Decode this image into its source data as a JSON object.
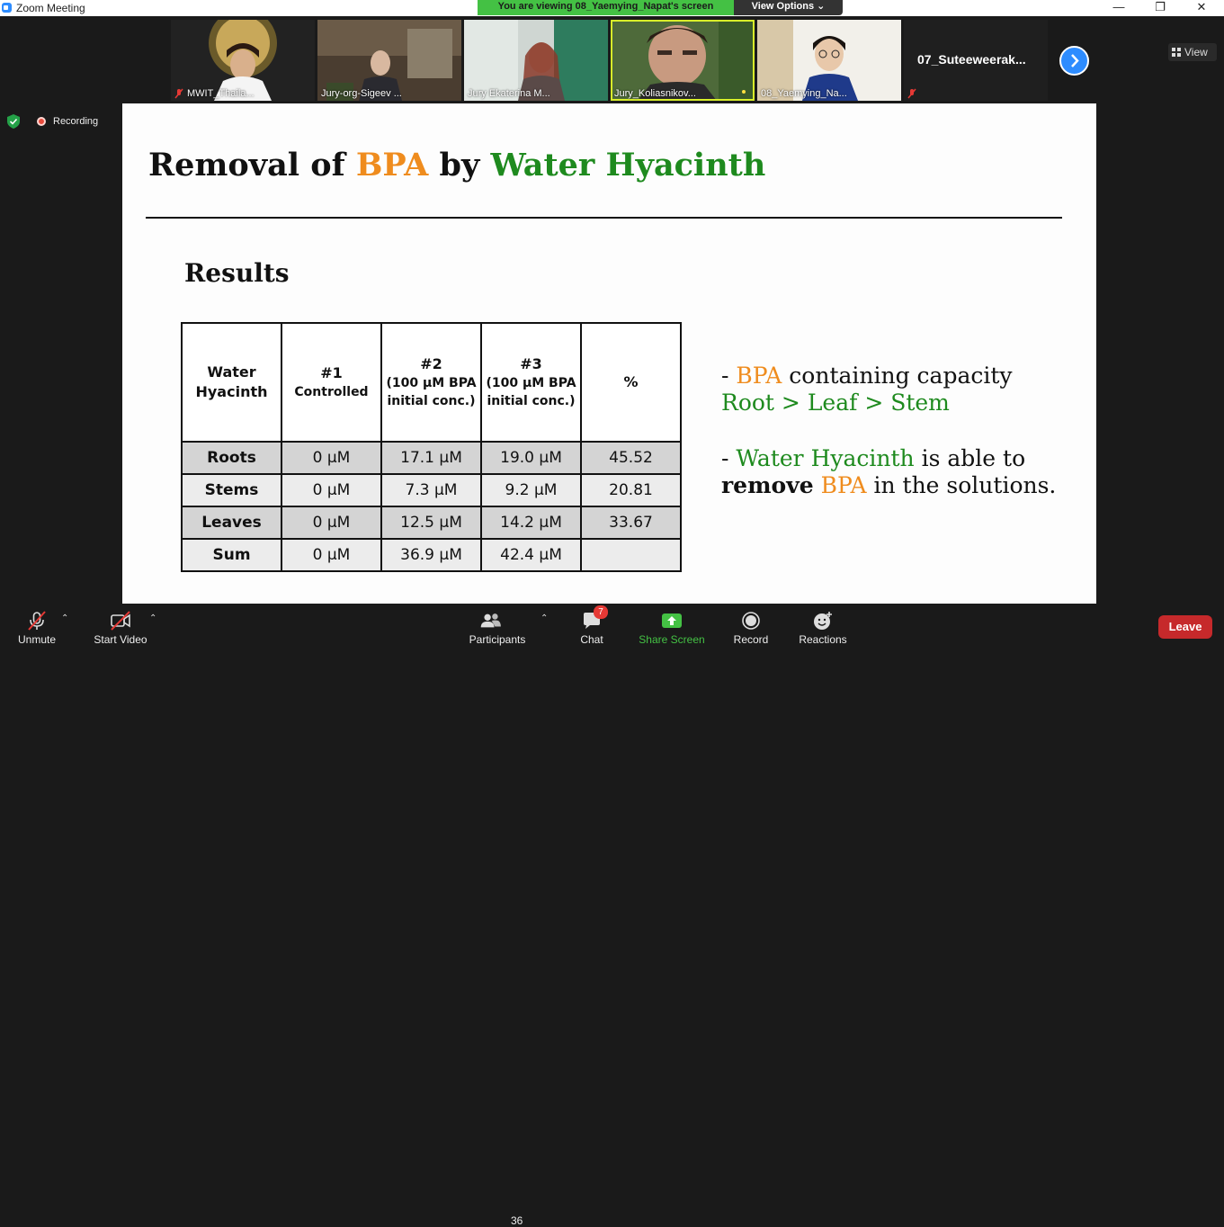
{
  "window": {
    "title": "Zoom Meeting"
  },
  "banner": {
    "text": "You are viewing 08_Yaemying_Napat's screen",
    "view_options": "View Options ⌄"
  },
  "participants_strip": [
    {
      "name": "MWIT_Thaila...",
      "muted": true
    },
    {
      "name": "Jury-org-Sigeev ...",
      "muted": false
    },
    {
      "name": "Jury Ekaterina M...",
      "muted": false
    },
    {
      "name": "Jury_Koliasnikov...",
      "muted": false,
      "active": true
    },
    {
      "name": "08_Yaemying_Na...",
      "muted": false
    },
    {
      "name": "07_Suteeweerak...",
      "muted": true
    }
  ],
  "view_button": "View",
  "status": {
    "recording": "Recording"
  },
  "slide": {
    "title_part1": "Removal of ",
    "title_bpa": "BPA",
    "title_part2": " by ",
    "title_plant": "Water Hyacinth",
    "results_heading": "Results",
    "table": {
      "headers": [
        {
          "main": "Water Hyacinth",
          "sub": ""
        },
        {
          "main": "#1",
          "sub": "Controlled"
        },
        {
          "main": "#2",
          "sub": "(100 μM BPA initial conc.)"
        },
        {
          "main": "#3",
          "sub": "(100 μM BPA initial conc.)"
        },
        {
          "main": "%",
          "sub": ""
        }
      ],
      "rows": [
        [
          "Roots",
          "0 μM",
          "17.1 μM",
          "19.0 μM",
          "45.52"
        ],
        [
          "Stems",
          "0 μM",
          "7.3 μM",
          "9.2 μM",
          "20.81"
        ],
        [
          "Leaves",
          "0 μM",
          "12.5 μM",
          "14.2 μM",
          "33.67"
        ],
        [
          "Sum",
          "0 μM",
          "36.9 μM",
          "42.4 μM",
          ""
        ]
      ]
    },
    "bullet1": {
      "dash": "- ",
      "bpa": "BPA",
      "rest": " containing capacity",
      "line2": "Root > Leaf > Stem"
    },
    "bullet2": {
      "dash": "- ",
      "plant": "Water Hyacinth",
      "rest": " is able to",
      "remove": "remove",
      "bpa": "BPA",
      "tail": " in the solutions."
    }
  },
  "toolbar": {
    "unmute": "Unmute",
    "start_video": "Start Video",
    "participants": "Participants",
    "participants_count": "36",
    "chat": "Chat",
    "chat_badge": "7",
    "share_screen": "Share Screen",
    "record": "Record",
    "reactions": "Reactions",
    "leave": "Leave"
  },
  "colors": {
    "accent_blue": "#2d8cff",
    "share_green": "#44c144",
    "leave_red": "#c6292b",
    "bpa_orange": "#ef8c1e",
    "plant_green": "#1e8a1e"
  }
}
